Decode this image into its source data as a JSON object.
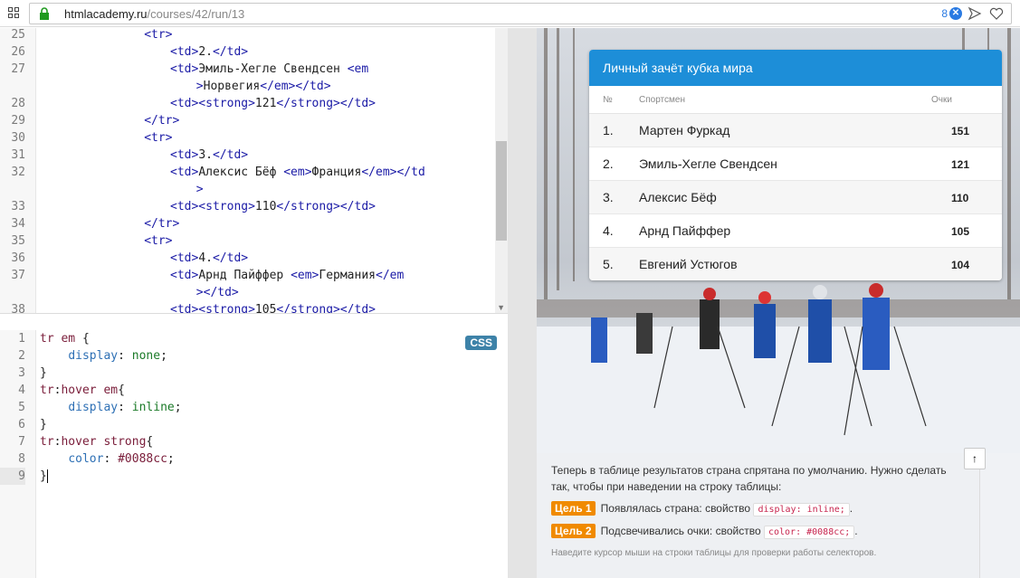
{
  "browser": {
    "url_host": "htmlacademy.ru",
    "url_path": "/courses/42/run/13",
    "ext_count": "8",
    "ext_badge": "✕"
  },
  "html_code": [
    {
      "num": "25",
      "parts": [
        [
          "tg",
          "<tr>"
        ]
      ],
      "indent": 16
    },
    {
      "num": "26",
      "parts": [
        [
          "tg",
          "<td>"
        ],
        [
          "tx",
          "2."
        ],
        [
          "tg",
          "</td>"
        ]
      ],
      "indent": 20
    },
    {
      "num": "27",
      "parts": [
        [
          "tg",
          "<td>"
        ],
        [
          "tx",
          "Эмиль-Хегле Свендсен "
        ],
        [
          "tg",
          "<em"
        ]
      ],
      "indent": 20
    },
    {
      "num": "",
      "parts": [
        [
          "tg",
          ">"
        ],
        [
          "tx",
          "Норвегия"
        ],
        [
          "tg",
          "</em></td>"
        ]
      ],
      "indent": 24
    },
    {
      "num": "28",
      "parts": [
        [
          "tg",
          "<td><strong>"
        ],
        [
          "tx",
          "121"
        ],
        [
          "tg",
          "</strong></td>"
        ]
      ],
      "indent": 20
    },
    {
      "num": "29",
      "parts": [
        [
          "tg",
          "</tr>"
        ]
      ],
      "indent": 16
    },
    {
      "num": "30",
      "parts": [
        [
          "tg",
          "<tr>"
        ]
      ],
      "indent": 16
    },
    {
      "num": "31",
      "parts": [
        [
          "tg",
          "<td>"
        ],
        [
          "tx",
          "3."
        ],
        [
          "tg",
          "</td>"
        ]
      ],
      "indent": 20
    },
    {
      "num": "32",
      "parts": [
        [
          "tg",
          "<td>"
        ],
        [
          "tx",
          "Алексис Бёф "
        ],
        [
          "tg",
          "<em>"
        ],
        [
          "tx",
          "Франция"
        ],
        [
          "tg",
          "</em></td"
        ]
      ],
      "indent": 20
    },
    {
      "num": "",
      "parts": [
        [
          "tg",
          ">"
        ]
      ],
      "indent": 24
    },
    {
      "num": "33",
      "parts": [
        [
          "tg",
          "<td><strong>"
        ],
        [
          "tx",
          "110"
        ],
        [
          "tg",
          "</strong></td>"
        ]
      ],
      "indent": 20
    },
    {
      "num": "34",
      "parts": [
        [
          "tg",
          "</tr>"
        ]
      ],
      "indent": 16
    },
    {
      "num": "35",
      "parts": [
        [
          "tg",
          "<tr>"
        ]
      ],
      "indent": 16
    },
    {
      "num": "36",
      "parts": [
        [
          "tg",
          "<td>"
        ],
        [
          "tx",
          "4."
        ],
        [
          "tg",
          "</td>"
        ]
      ],
      "indent": 20
    },
    {
      "num": "37",
      "parts": [
        [
          "tg",
          "<td>"
        ],
        [
          "tx",
          "Арнд Пайффер "
        ],
        [
          "tg",
          "<em>"
        ],
        [
          "tx",
          "Германия"
        ],
        [
          "tg",
          "</em"
        ]
      ],
      "indent": 20
    },
    {
      "num": "",
      "parts": [
        [
          "tg",
          "></td>"
        ]
      ],
      "indent": 24
    },
    {
      "num": "38",
      "parts": [
        [
          "tg",
          "<td><strong>"
        ],
        [
          "tx",
          "105"
        ],
        [
          "tg",
          "</strong></td>"
        ]
      ],
      "indent": 20
    }
  ],
  "css_code": [
    {
      "num": "1",
      "parts": [
        [
          "sel",
          "tr em"
        ],
        [
          "pun",
          " {"
        ]
      ]
    },
    {
      "num": "2",
      "parts": [
        [
          "pun",
          "    "
        ],
        [
          "prop",
          "display"
        ],
        [
          "pun",
          ": "
        ],
        [
          "val",
          "none"
        ],
        [
          "pun",
          ";"
        ]
      ]
    },
    {
      "num": "3",
      "parts": [
        [
          "pun",
          "}"
        ]
      ]
    },
    {
      "num": "4",
      "parts": [
        [
          "sel",
          "tr"
        ],
        [
          "pun",
          ":"
        ],
        [
          "sel",
          "hover em"
        ],
        [
          "pun",
          "{"
        ]
      ]
    },
    {
      "num": "5",
      "parts": [
        [
          "pun",
          "    "
        ],
        [
          "prop",
          "display"
        ],
        [
          "pun",
          ": "
        ],
        [
          "val",
          "inline"
        ],
        [
          "pun",
          ";"
        ]
      ]
    },
    {
      "num": "6",
      "parts": [
        [
          "pun",
          "}"
        ]
      ]
    },
    {
      "num": "7",
      "parts": [
        [
          "sel",
          "tr"
        ],
        [
          "pun",
          ":"
        ],
        [
          "sel",
          "hover strong"
        ],
        [
          "pun",
          "{"
        ]
      ]
    },
    {
      "num": "8",
      "parts": [
        [
          "pun",
          "    "
        ],
        [
          "prop",
          "color"
        ],
        [
          "pun",
          ": "
        ],
        [
          "sel",
          "#0088cc"
        ],
        [
          "pun",
          ";"
        ]
      ]
    },
    {
      "num": "9",
      "parts": [
        [
          "pun",
          "}"
        ]
      ]
    }
  ],
  "css_badge": "CSS",
  "table": {
    "title": "Личный зачёт кубка мира",
    "headers": {
      "num": "№",
      "name": "Спортсмен",
      "points": "Очки"
    },
    "rows": [
      {
        "num": "1.",
        "name": "Мартен Фуркад",
        "points": "151"
      },
      {
        "num": "2.",
        "name": "Эмиль-Хегле Свендсен",
        "points": "121"
      },
      {
        "num": "3.",
        "name": "Алексис Бёф",
        "points": "110"
      },
      {
        "num": "4.",
        "name": "Арнд Пайффер",
        "points": "105"
      },
      {
        "num": "5.",
        "name": "Евгений Устюгов",
        "points": "104"
      }
    ]
  },
  "task": {
    "text": "Теперь в таблице результатов страна спрятана по умолчанию. Нужно сделать так, чтобы при наведении на строку таблицы:",
    "goal1_badge": "Цель 1",
    "goal1_text": "Появлялась страна: свойство",
    "goal1_code": "display: inline;",
    "goal2_badge": "Цель 2",
    "goal2_text": "Подсвечивались очки: свойство",
    "goal2_code": "color: #0088cc;",
    "hint": "Наведите курсор мыши на строки таблицы для проверки работы селекторов.",
    "up_icon": "↑"
  }
}
